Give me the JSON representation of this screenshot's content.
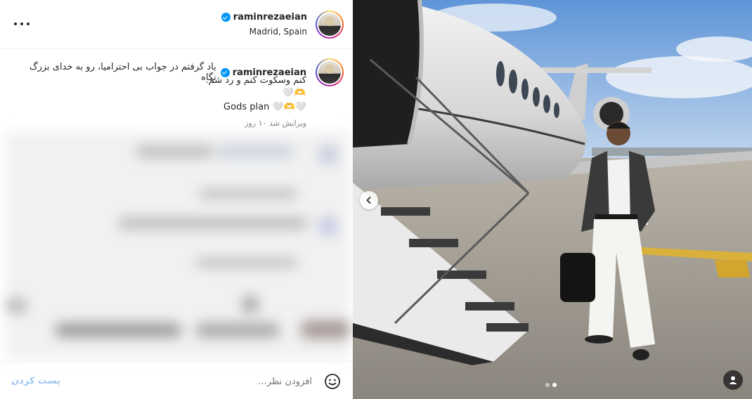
{
  "post": {
    "username": "raminrezaeian",
    "location": "Madrid, Spain",
    "caption_line1": "یاد گرفتم در جواب بی احترامیا، رو به خدای بزرگ نگاه",
    "caption_line2": "کنم وسکوت کنم و رد شم.",
    "caption_line3": "🤍🫶",
    "caption_line4": "Gods plan 🤍🫶🤍",
    "edited_time": "ویرایش شد ۱۰ روز",
    "comment_placeholder": "افزودن نظر...",
    "post_button_label": "پست کردن",
    "carousel": {
      "total": 2,
      "current": 2
    }
  },
  "icons": {
    "more": "more-horizontal-icon",
    "verified": "verified-badge-icon",
    "emoji": "emoji-smiley-icon",
    "prev": "chevron-left-icon",
    "tag": "user-tag-icon"
  },
  "colors": {
    "verified_blue": "#0095f6",
    "post_button_disabled": "#9fc6f1",
    "secondary_text": "#737373"
  }
}
